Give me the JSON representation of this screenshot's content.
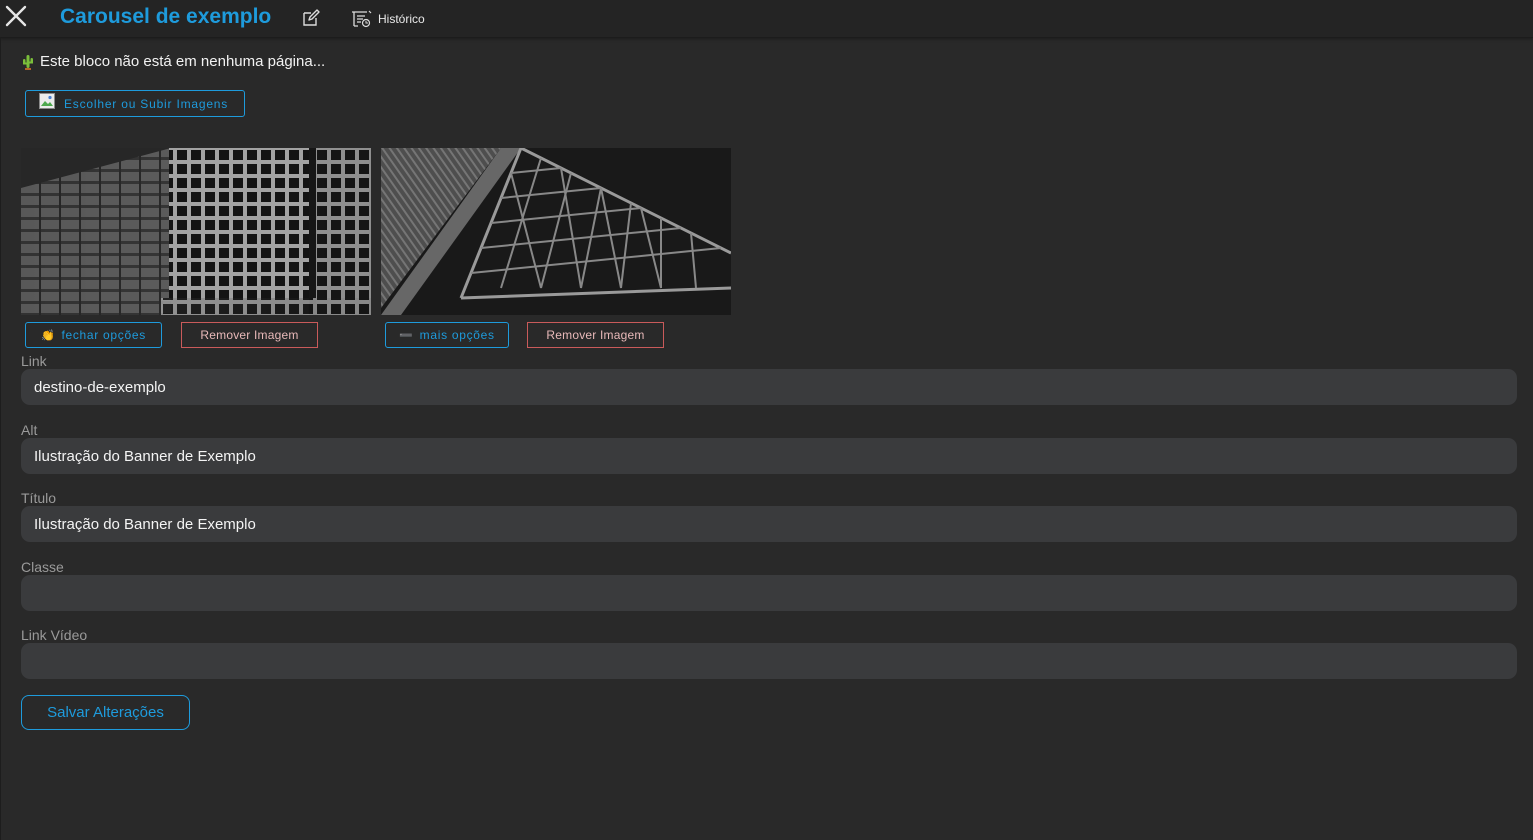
{
  "header": {
    "title": "Carousel de exemplo",
    "history_label": "Histórico"
  },
  "notice": {
    "text": "Este bloco não está em nenhuma página..."
  },
  "upload": {
    "label": "Escolher ou Subir Imagens"
  },
  "images": [
    {
      "subject": "steel tubes stacked",
      "options_emoji": "👏",
      "options_label": "fechar opções",
      "remove_label": "Remover Imagem"
    },
    {
      "subject": "metal roof trusses",
      "options_emoji": "➖",
      "options_label": "mais opções",
      "remove_label": "Remover Imagem"
    }
  ],
  "fields": {
    "link": {
      "label": "Link",
      "value": "destino-de-exemplo"
    },
    "alt": {
      "label": "Alt",
      "value": "Ilustração do Banner de Exemplo"
    },
    "titulo": {
      "label": "Título",
      "value": "Ilustração do Banner de Exemplo"
    },
    "classe": {
      "label": "Classe",
      "value": ""
    },
    "link_video": {
      "label": "Link Vídeo",
      "value": ""
    }
  },
  "save": {
    "label": "Salvar Alterações"
  },
  "colors": {
    "accent": "#1e9bdc",
    "danger_border": "#c95a5a",
    "background": "#292929",
    "input_bg": "#3a3b3d"
  }
}
